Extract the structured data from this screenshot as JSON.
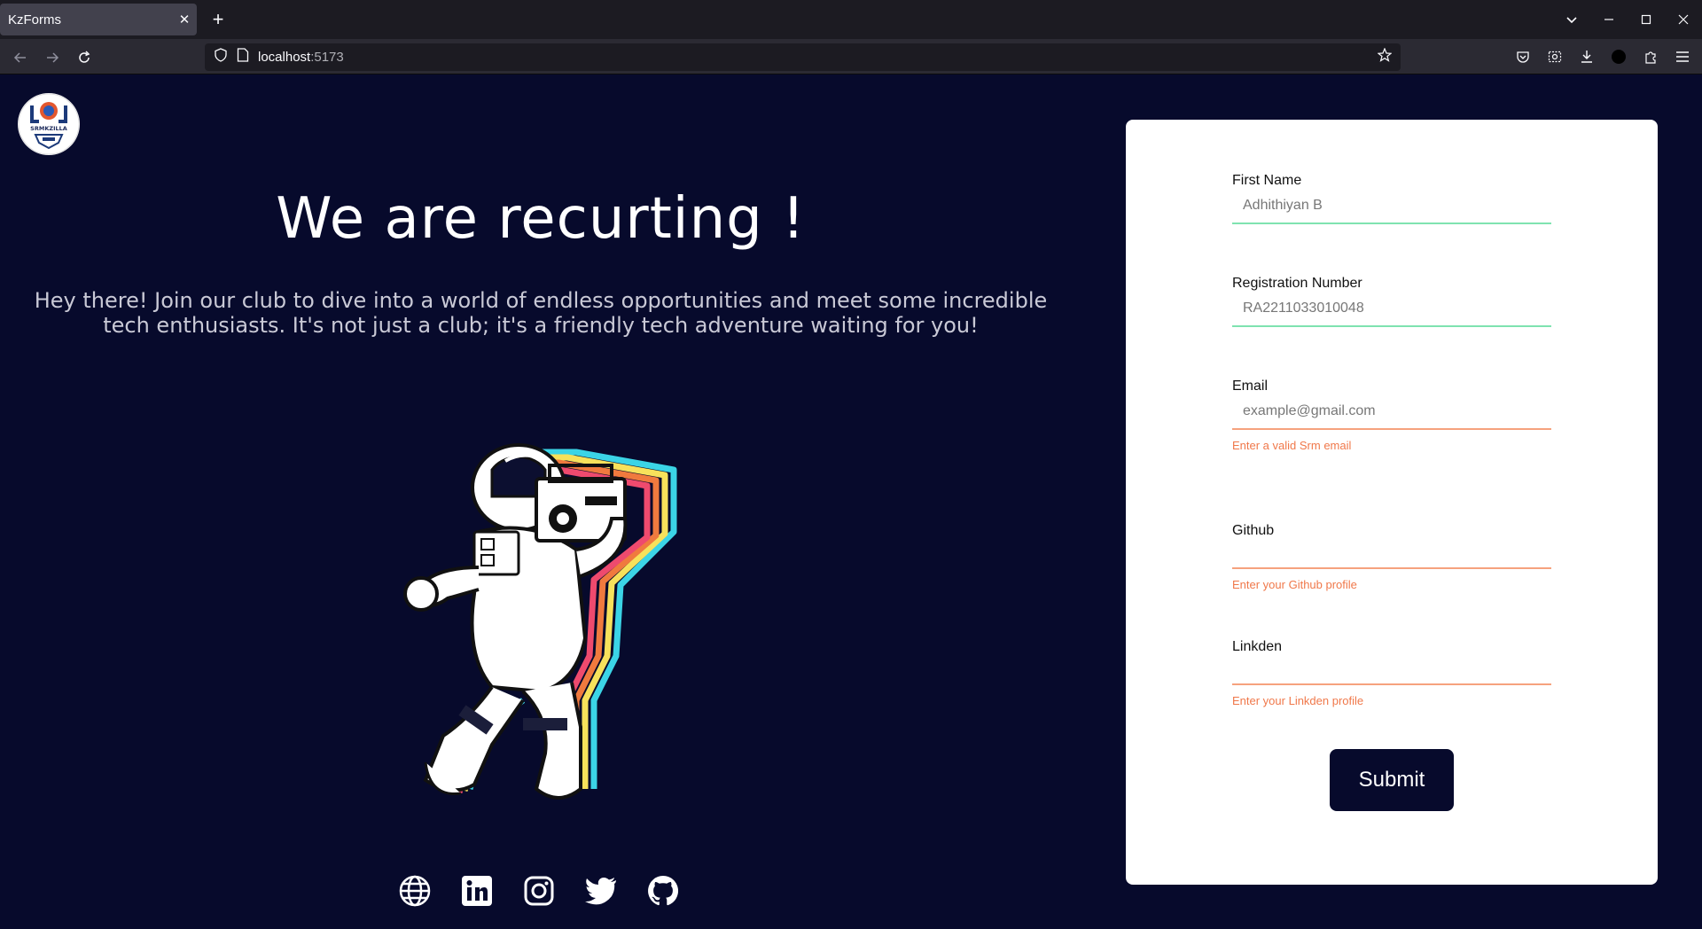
{
  "browser": {
    "tab_title": "KzForms",
    "url_host": "localhost",
    "url_port": ":5173"
  },
  "logo": {
    "text": "SRMKZILLA"
  },
  "hero": {
    "title": "We are recurting !",
    "subtitle": "Hey there! Join our club to dive into a world of endless opportunities and meet some incredible tech enthusiasts. It's not just a club; it's a friendly tech adventure waiting for you!"
  },
  "socials": [
    "globe-icon",
    "linkedin-icon",
    "instagram-icon",
    "twitter-icon",
    "github-icon"
  ],
  "form": {
    "first_name": {
      "label": "First Name",
      "value": "Adhithiyan B"
    },
    "reg_no": {
      "label": "Registration Number",
      "value": "RA2211033010048"
    },
    "email": {
      "label": "Email",
      "placeholder": "example@gmail.com",
      "error": "Enter a valid Srm email"
    },
    "github": {
      "label": "Github",
      "value": "",
      "error": "Enter your Github profile"
    },
    "linkedin": {
      "label": "Linkden",
      "value": "",
      "error": "Enter your Linkden profile"
    },
    "submit_label": "Submit"
  },
  "colors": {
    "page_bg": "#070a2c",
    "valid_underline": "#7fe3b0",
    "error_underline": "#f6a27e",
    "error_text": "#f0784a"
  }
}
